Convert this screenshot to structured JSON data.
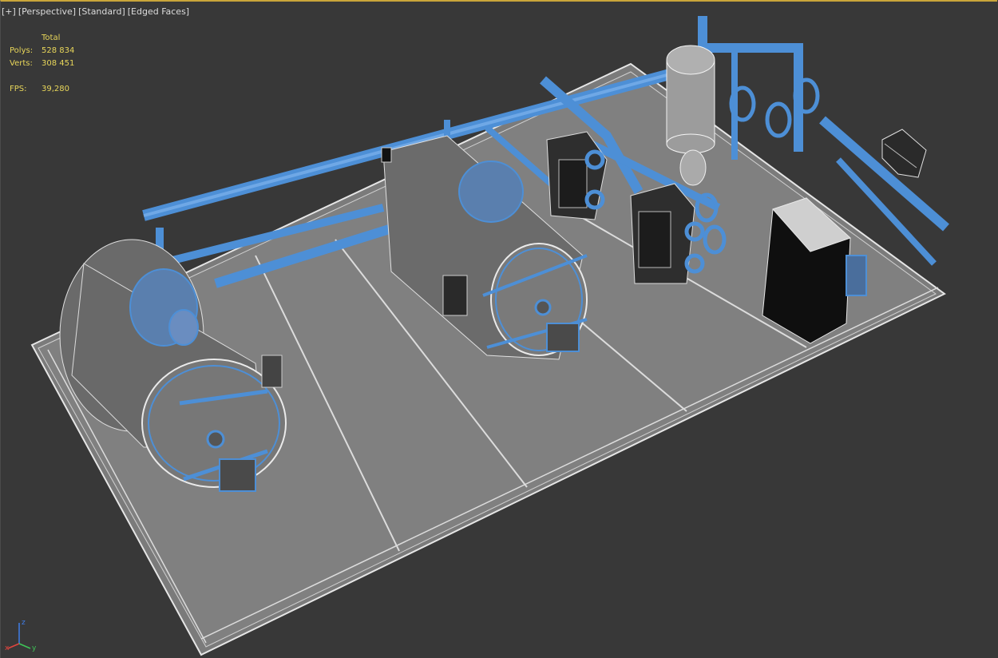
{
  "viewport": {
    "labels": {
      "plus": "[+]",
      "view": "[Perspective]",
      "shading": "[Standard]",
      "edges": "[Edged Faces]"
    },
    "stats": {
      "header": "Total",
      "polys_label": "Polys:",
      "polys_value": "528 834",
      "verts_label": "Verts:",
      "verts_value": "308 451",
      "fps_label": "FPS:",
      "fps_value": "39,280"
    },
    "axis": {
      "x": "x",
      "y": "y",
      "z": "z"
    }
  },
  "colors": {
    "background": "#383838",
    "active_border": "#c9a53a",
    "stats_text": "#e8d65a",
    "wire_blue": "#4d8fd6",
    "floor": "#7d7d7d"
  }
}
